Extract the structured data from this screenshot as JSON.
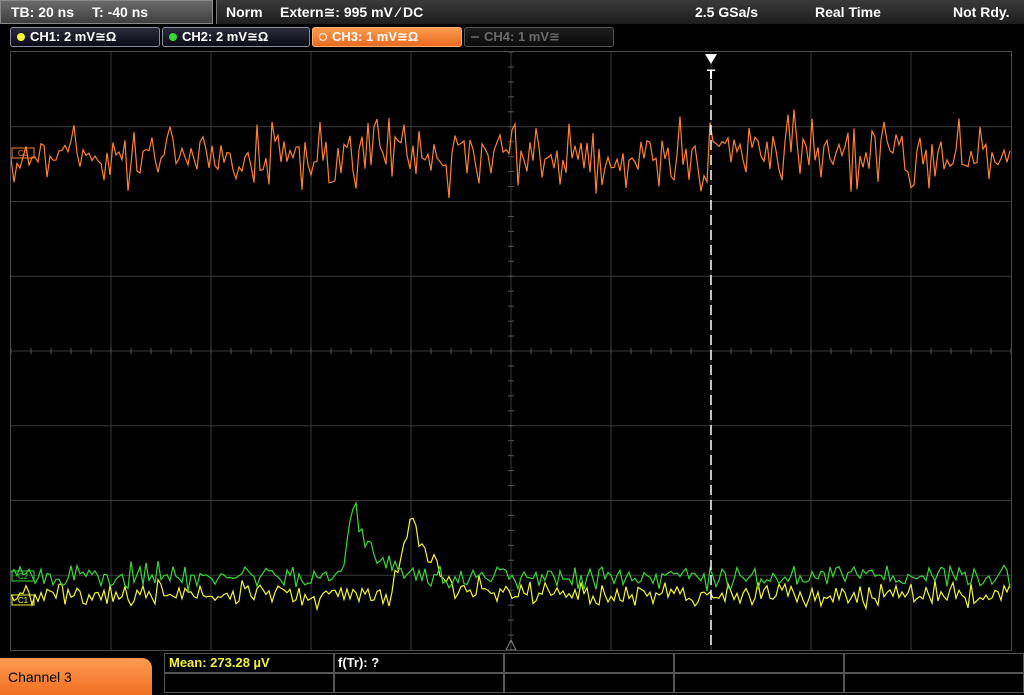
{
  "status": {
    "timebase": "TB: 20 ns",
    "trigger_offset": "T: -40 ns",
    "trigger_mode": "Norm",
    "trigger_source": "Extern≅: 995 mV ⁄ DC",
    "sample_rate": "2.5 GSa/s",
    "acq_mode": "Real Time",
    "state": "Not Rdy."
  },
  "channels": [
    {
      "label": "CH1: 2 mV≅Ω",
      "color": "#f5f532",
      "state": "on"
    },
    {
      "label": "CH2: 2 mV≅Ω",
      "color": "#38d838",
      "state": "on"
    },
    {
      "label": "CH3: 1 mV≅Ω",
      "color": "#ff8030",
      "state": "active"
    },
    {
      "label": "CH4: 1 mV≅",
      "color": "#555555",
      "state": "off"
    }
  ],
  "markers": {
    "trigger": "T",
    "ch3_marker": "C3",
    "ch2_marker": "C2",
    "ch1_marker": "C1"
  },
  "bottom": {
    "channel_label": "Channel 3",
    "mean": "Mean: 273.28 µV",
    "ftr": "f(Tr): ?"
  },
  "colors": {
    "ch1": "#f5f532",
    "ch2": "#38d838",
    "ch3": "#ff8030",
    "grid": "#3a3a3a",
    "trigger_line": "#ffffff"
  }
}
